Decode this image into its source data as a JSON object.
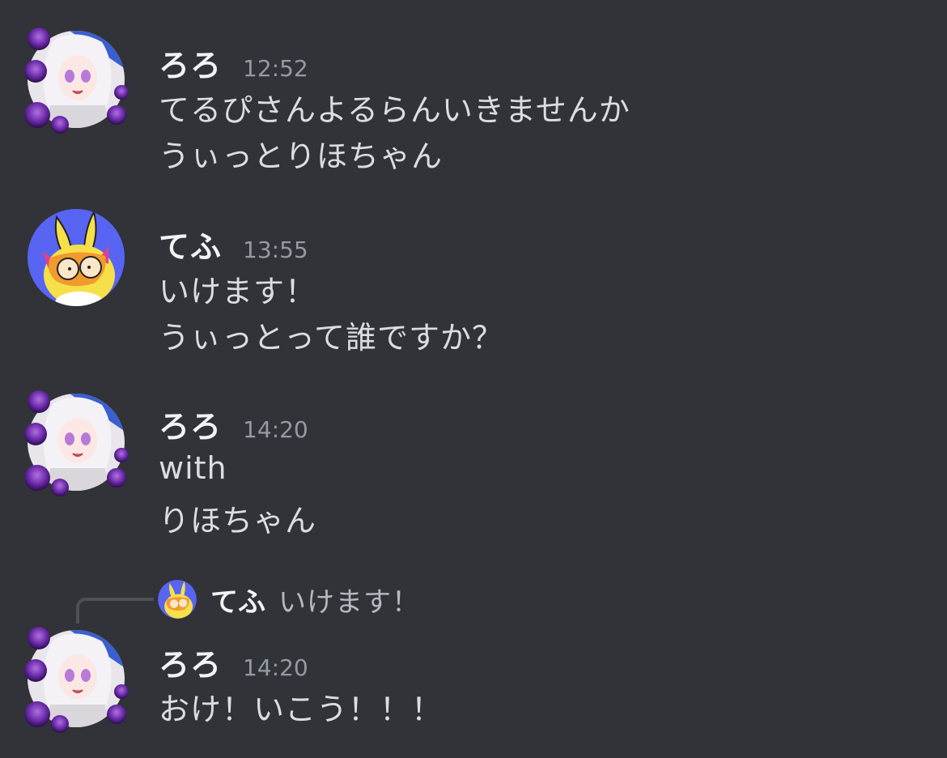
{
  "messages": [
    {
      "author": "ろろ",
      "time": "12:52",
      "lines": [
        "てるぴさんよるらんいきませんか",
        "うぃっとりほちゃん"
      ]
    },
    {
      "author": "てふ",
      "time": "13:55",
      "lines": [
        "いけます！",
        "うぃっとって誰ですか？"
      ]
    },
    {
      "author": "ろろ",
      "time": "14:20",
      "lines": [
        "with",
        "りほちゃん"
      ]
    },
    {
      "author": "ろろ",
      "time": "14:20",
      "reply": {
        "author": "てふ",
        "text": "いけます！"
      },
      "lines": [
        "おけ！いこう！！！"
      ]
    }
  ],
  "icons": {
    "roro_avatar": "anime-girl-rose-avatar-icon",
    "tefu_avatar": "yellow-rabbit-avatar-icon"
  },
  "colors": {
    "background": "#313338",
    "username": "#f2f3f5",
    "timestamp": "#949ba4",
    "message_text": "#dbdee1",
    "tefu_avatar_bg": "#5865f2"
  }
}
